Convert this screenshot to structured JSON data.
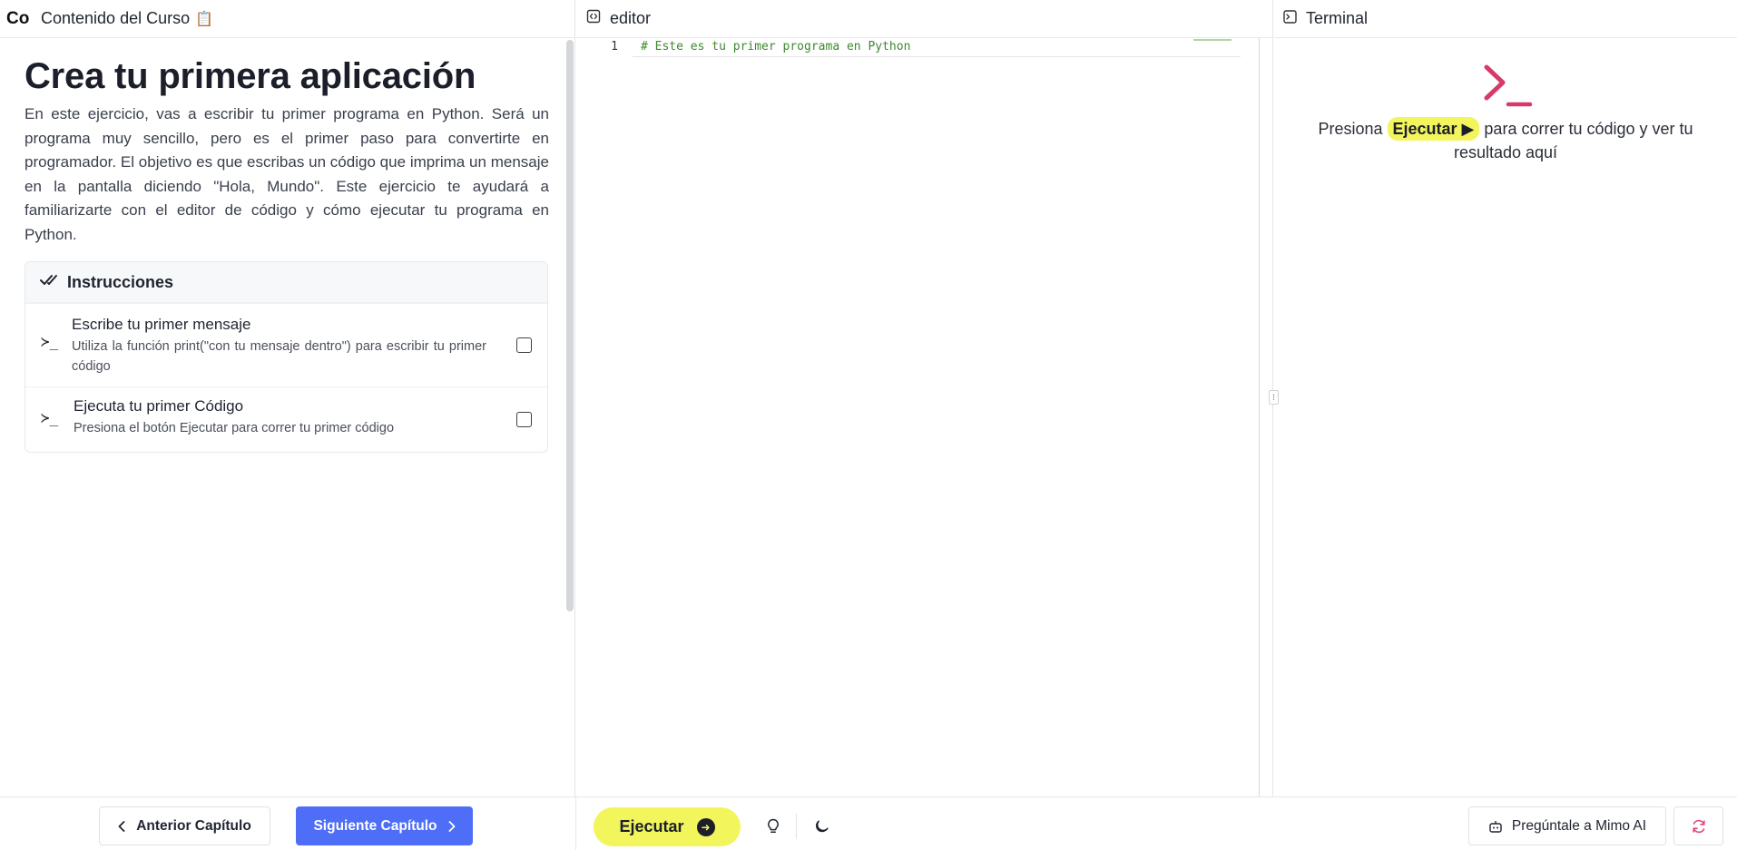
{
  "left": {
    "logo": "Co",
    "course_title": "Contenido del Curso",
    "course_title_emoji": "📋",
    "lesson_title": "Crea tu primera aplicación",
    "lesson_description": "En este ejercicio, vas a escribir tu primer programa en Python. Será un programa muy sencillo, pero es el primer paso para convertirte en programador. El objetivo es que escribas un código que imprima un mensaje en la pantalla diciendo \"Hola, Mundo\". Este ejercicio te ayudará a familiarizarte con el editor de código y cómo ejecutar tu programa en Python.",
    "instructions": {
      "heading": "Instrucciones",
      "tasks": [
        {
          "prompt": "≻_",
          "title": "Escribe tu primer mensaje",
          "description": "Utiliza la función print(\"con tu mensaje dentro\") para escribir tu primer código",
          "checked": false
        },
        {
          "prompt": "≻_",
          "title": "Ejecuta tu primer Código",
          "description": "Presiona el botón Ejecutar para correr tu primer código",
          "checked": false
        }
      ]
    }
  },
  "editor": {
    "title": "editor",
    "lines": [
      {
        "number": "1",
        "text": "# Este es tu primer programa en Python"
      }
    ]
  },
  "terminal": {
    "title": "Terminal",
    "hint_before": "Presiona",
    "hint_chip": "Ejecutar ▶",
    "hint_after": "para correr tu código y ver tu resultado aquí",
    "accent_color": "#d63a6b"
  },
  "footer": {
    "prev_label": "Anterior Capítulo",
    "next_label": "Siguiente Capítulo",
    "run_label": "Ejecutar",
    "mimo_label": "Pregúntale a Mimo AI"
  },
  "colors": {
    "primary_blue": "#4f6ef7",
    "run_yellow": "#f2f55c",
    "comment_green": "#3d8a2e",
    "reset_pink": "#e4457a"
  }
}
